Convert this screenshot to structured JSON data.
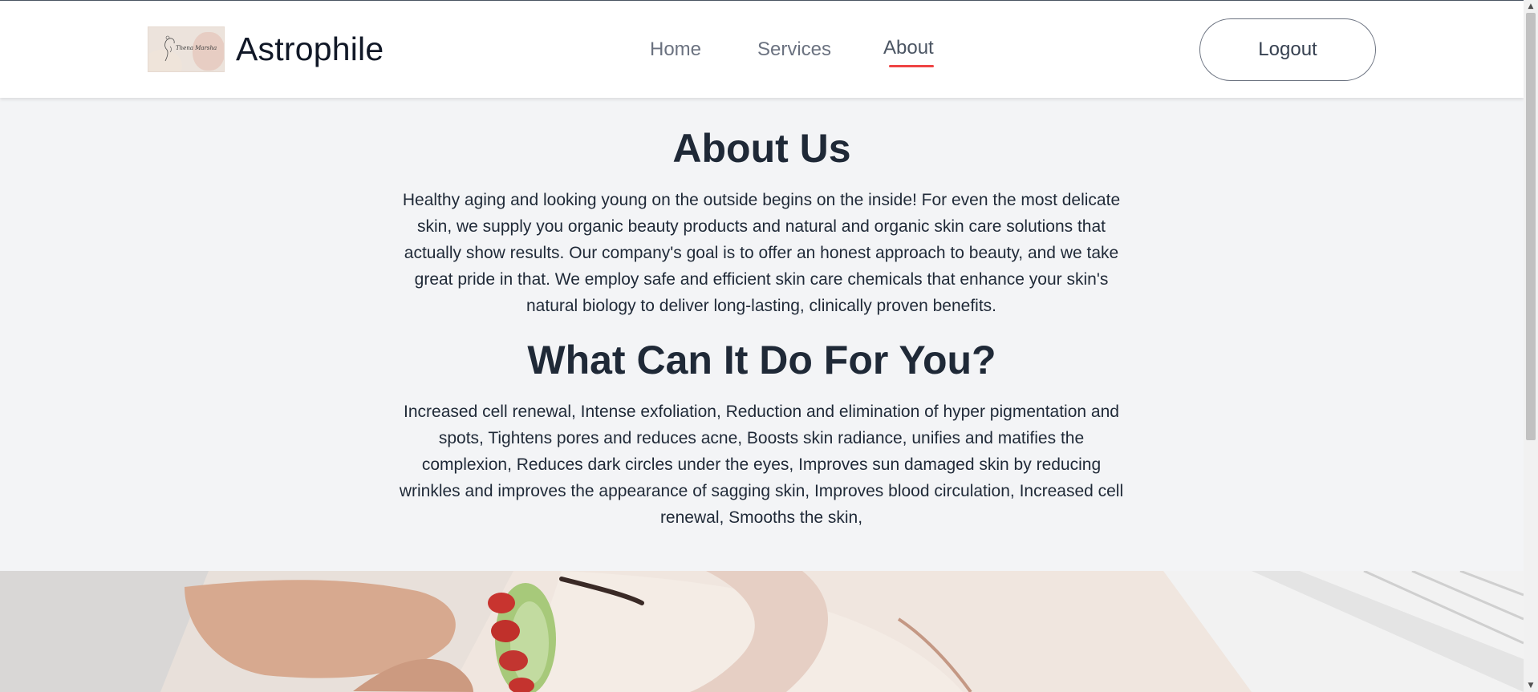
{
  "header": {
    "logo_script_text": "Thena Marsha",
    "brand_name": "Astrophile",
    "nav": {
      "home": "Home",
      "services": "Services",
      "about": "About"
    },
    "logout_label": "Logout",
    "accent_color": "#ef4444"
  },
  "about": {
    "title": "About Us",
    "paragraph": "Healthy aging and looking young on the outside begins on the inside! For even the most delicate skin, we supply you organic beauty products and natural and organic skin care solutions that actually show results. Our company's goal is to offer an honest approach to beauty, and we take great pride in that. We employ safe and efficient skin care chemicals that enhance your skin's natural biology to deliver long-lasting, clinically proven benefits."
  },
  "benefits": {
    "title": "What Can It Do For You?",
    "paragraph": "Increased cell renewal, Intense exfoliation, Reduction and elimination of hyper pigmentation and spots, Tightens pores and reduces acne, Boosts skin radiance, unifies and matifies the complexion, Reduces dark circles under the eyes, Improves sun damaged skin by reducing wrinkles and improves the appearance of sagging skin, Improves blood circulation, Increased cell renewal, Smooths the skin,"
  },
  "icons": {
    "scroll_up": "scroll-up-arrow-icon",
    "scroll_down": "scroll-down-arrow-icon"
  }
}
